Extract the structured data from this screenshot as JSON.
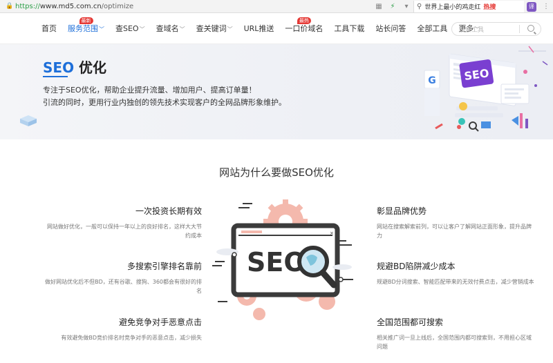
{
  "browser": {
    "url_scheme": "https://",
    "url_host": "www.md5.com.cn",
    "url_path": "/optimize",
    "search_text": "世界上最小的鸡走红",
    "search_hot": "热搜",
    "ext_label": "译"
  },
  "nav": {
    "items": [
      {
        "label": "首页",
        "chevron": false
      },
      {
        "label": "服务范围",
        "chevron": true,
        "badge": "最新",
        "active": true
      },
      {
        "label": "查SEO",
        "chevron": true
      },
      {
        "label": "查域名",
        "chevron": true
      },
      {
        "label": "查关键词",
        "chevron": true
      },
      {
        "label": "URL推送",
        "chevron": false
      },
      {
        "label": "一口价域名",
        "chevron": false,
        "badge": "最热"
      },
      {
        "label": "工具下载",
        "chevron": false
      },
      {
        "label": "站长问答",
        "chevron": false
      },
      {
        "label": "全部工具",
        "chevron": false
      },
      {
        "label": "更多",
        "chevron": true
      }
    ],
    "search_placeholder": "搜索工具"
  },
  "banner": {
    "title_seo": "SEO",
    "title_rest": "优化",
    "line1": "专注于SEO优化，帮助企业提升流量、增加用户、提高订单量！",
    "line2": "引流的同时，更用行业内独创的领先技术实现客户的全网品牌形象维护。",
    "art_text": "SEO",
    "art_letter": "G"
  },
  "section": {
    "title": "网站为什么要做SEO优化",
    "illustration_text": "SEO",
    "features_left": [
      {
        "title": "一次投资长期有效",
        "desc": "网站做好优化，一般可以保持一年以上的良好排名，这样大大节约成本"
      },
      {
        "title": "多搜索引擎排名靠前",
        "desc": "做好网站优化后不但BD，还有谷歌、搜狗、360都会有很好的排名"
      },
      {
        "title": "避免竞争对手恶意点击",
        "desc": "有效避免做BD竞价排名时竞争对手的恶意点击，减少损失"
      }
    ],
    "features_right": [
      {
        "title": "彰显品牌优势",
        "desc": "网站在搜索解索前列，可以让客户了解网站正面形象，提升品牌力"
      },
      {
        "title": "规避BD陷阱减少成本",
        "desc": "规避BD分词搜索、智能匹配带来的无效付费点击，减少营销成本"
      },
      {
        "title": "全国范围都可搜索",
        "desc": "相关推广词一旦上线后，全国范围内都可搜索到，不用担心区域问题"
      }
    ]
  },
  "colors": {
    "accent": "#1e6fd9",
    "badge": "#e53935",
    "gear": "#f2b5a8",
    "dark": "#3b3b3b"
  }
}
